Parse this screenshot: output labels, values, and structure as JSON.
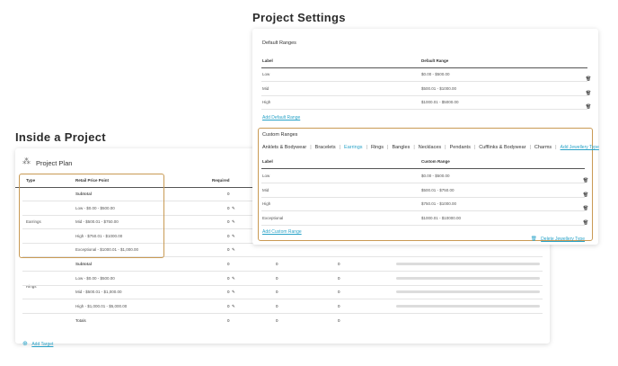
{
  "titles": {
    "project_settings": "Project Settings",
    "inside_project": "Inside a Project"
  },
  "settings": {
    "default_ranges_title": "Default Ranges",
    "col_label": "Label",
    "col_default_range": "Default Range",
    "default_rows": [
      {
        "label": "Low",
        "range": "$0.00 - $500.00"
      },
      {
        "label": "Mid",
        "range": "$500.01 - $1000.00"
      },
      {
        "label": "High",
        "range": "$1000.01 - $5000.00"
      }
    ],
    "add_default_range": "Add Default Range",
    "custom_ranges_title": "Custom Ranges",
    "tabs": [
      "Anklets & Bodywear",
      "Bracelets",
      "Earrings",
      "Rings",
      "Bangles",
      "Necklaces",
      "Pendants",
      "Cufflinks & Bodywear",
      "Charms"
    ],
    "active_tab": "Earrings",
    "add_jewellery_type": "Add Jewellery Type",
    "col_custom_range": "Custom Range",
    "custom_rows": [
      {
        "label": "Low",
        "range": "$0.00 - $500.00"
      },
      {
        "label": "Mid",
        "range": "$500.01 - $750.00"
      },
      {
        "label": "High",
        "range": "$750.01 - $1000.00"
      },
      {
        "label": "Exceptional",
        "range": "$1000.01 - $10000.00"
      }
    ],
    "add_custom_range": "Add Custom Range",
    "delete_jewellery_type": "Delete Jewellery Type"
  },
  "plan": {
    "title": "Project Plan",
    "col_type": "Type",
    "col_retail": "Retail Price Point",
    "col_required": "Required",
    "earrings_label": "Earrings",
    "rings_label": "Rings",
    "earrings_rows": [
      {
        "label": "Subtotal",
        "required": "0",
        "c2": "",
        "c3": ""
      },
      {
        "label": "Low - $0.00 - $500.00",
        "required": "0",
        "c2": "",
        "c3": ""
      },
      {
        "label": "Mid - $500.01 - $750.00",
        "required": "0",
        "c2": "",
        "c3": ""
      },
      {
        "label": "High - $750.01 - $1000.00",
        "required": "0",
        "c2": "",
        "c3": ""
      },
      {
        "label": "Exceptional - $1000.01 - $1,000.00",
        "required": "0",
        "c2": "",
        "c3": ""
      }
    ],
    "rings_rows": [
      {
        "label": "Subtotal",
        "required": "0",
        "c2": "0",
        "c3": "0"
      },
      {
        "label": "Low - $0.00 - $500.00",
        "required": "0",
        "c2": "0",
        "c3": "0"
      },
      {
        "label": "Mid - $500.01 - $1,000.00",
        "required": "0",
        "c2": "0",
        "c3": "0"
      },
      {
        "label": "High - $1,000.01 - $5,000.00",
        "required": "0",
        "c2": "0",
        "c3": "0"
      }
    ],
    "totals_label": "Totals",
    "totals": {
      "required": "0",
      "c2": "0",
      "c3": "0"
    },
    "add_target": "Add Target"
  },
  "icons": {
    "edit": "pencil-icon",
    "delete": "trash-icon",
    "plan": "nodes-icon",
    "add": "plus-circle-icon"
  },
  "colors": {
    "accent": "#2aa3c8",
    "highlight": "#c99a54"
  }
}
